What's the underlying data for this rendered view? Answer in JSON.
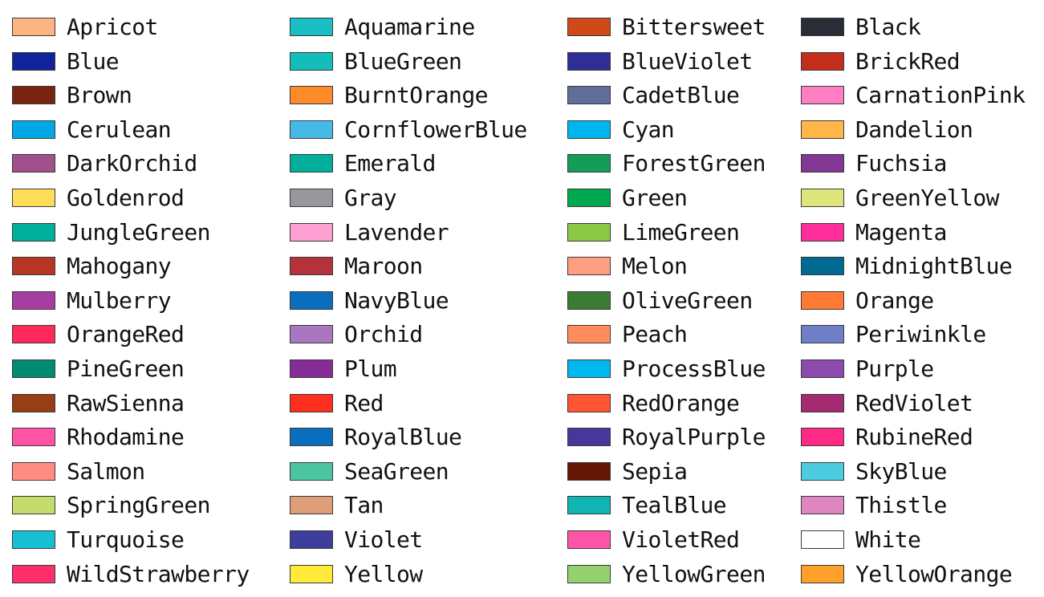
{
  "columns": [
    {
      "items": [
        {
          "name": "Apricot",
          "color": "#FBB482"
        },
        {
          "name": "Blue",
          "color": "#10239A"
        },
        {
          "name": "Brown",
          "color": "#792310"
        },
        {
          "name": "Cerulean",
          "color": "#00A9E6"
        },
        {
          "name": "DarkOrchid",
          "color": "#A2508C"
        },
        {
          "name": "Goldenrod",
          "color": "#FFDC5A"
        },
        {
          "name": "JungleGreen",
          "color": "#00B09C"
        },
        {
          "name": "Mahogany",
          "color": "#B73525"
        },
        {
          "name": "Mulberry",
          "color": "#A63EA0"
        },
        {
          "name": "OrangeRed",
          "color": "#FF2A5A"
        },
        {
          "name": "PineGreen",
          "color": "#008B72"
        },
        {
          "name": "RawSienna",
          "color": "#973E12"
        },
        {
          "name": "Rhodamine",
          "color": "#FF53A5"
        },
        {
          "name": "Salmon",
          "color": "#FF8C82"
        },
        {
          "name": "SpringGreen",
          "color": "#C4DC6A"
        },
        {
          "name": "Turquoise",
          "color": "#16C0D2"
        },
        {
          "name": "WildStrawberry",
          "color": "#FF2E6A"
        }
      ]
    },
    {
      "items": [
        {
          "name": "Aquamarine",
          "color": "#19BFC3"
        },
        {
          "name": "BlueGreen",
          "color": "#13BDBA"
        },
        {
          "name": "BurntOrange",
          "color": "#FF8A2A"
        },
        {
          "name": "CornflowerBlue",
          "color": "#46BAE6"
        },
        {
          "name": "Emerald",
          "color": "#00AE9B"
        },
        {
          "name": "Gray",
          "color": "#98989C"
        },
        {
          "name": "Lavender",
          "color": "#FFA0D2"
        },
        {
          "name": "Maroon",
          "color": "#B5323A"
        },
        {
          "name": "NavyBlue",
          "color": "#0A6EBE"
        },
        {
          "name": "Orchid",
          "color": "#A877BF"
        },
        {
          "name": "Plum",
          "color": "#852C96"
        },
        {
          "name": "Red",
          "color": "#FF2E1F"
        },
        {
          "name": "RoyalBlue",
          "color": "#0A6EBF"
        },
        {
          "name": "SeaGreen",
          "color": "#4AC59F"
        },
        {
          "name": "Tan",
          "color": "#DE9E7A"
        },
        {
          "name": "Violet",
          "color": "#3D3D9B"
        },
        {
          "name": "Yellow",
          "color": "#FFEA3A"
        }
      ]
    },
    {
      "items": [
        {
          "name": "Bittersweet",
          "color": "#CF4A18"
        },
        {
          "name": "BlueViolet",
          "color": "#2E2E96"
        },
        {
          "name": "CadetBlue",
          "color": "#606E9A"
        },
        {
          "name": "Cyan",
          "color": "#00B6EF"
        },
        {
          "name": "ForestGreen",
          "color": "#129E58"
        },
        {
          "name": "Green",
          "color": "#00A850"
        },
        {
          "name": "LimeGreen",
          "color": "#8BC846"
        },
        {
          "name": "Melon",
          "color": "#FF9E80"
        },
        {
          "name": "OliveGreen",
          "color": "#3C7B33"
        },
        {
          "name": "Peach",
          "color": "#FF8D5C"
        },
        {
          "name": "ProcessBlue",
          "color": "#00B8EF"
        },
        {
          "name": "RedOrange",
          "color": "#FF5533"
        },
        {
          "name": "RoyalPurple",
          "color": "#48369A"
        },
        {
          "name": "Sepia",
          "color": "#651503"
        },
        {
          "name": "TealBlue",
          "color": "#10B5B3"
        },
        {
          "name": "VioletRed",
          "color": "#FF55A8"
        },
        {
          "name": "YellowGreen",
          "color": "#93D16E"
        }
      ]
    },
    {
      "items": [
        {
          "name": "Black",
          "color": "#2A2D35"
        },
        {
          "name": "BrickRed",
          "color": "#C32D1C"
        },
        {
          "name": "CarnationPink",
          "color": "#FF7FC2"
        },
        {
          "name": "Dandelion",
          "color": "#FFB54A"
        },
        {
          "name": "Fuchsia",
          "color": "#833795"
        },
        {
          "name": "GreenYellow",
          "color": "#DDE57B"
        },
        {
          "name": "Magenta",
          "color": "#FF2E9C"
        },
        {
          "name": "MidnightBlue",
          "color": "#006A92"
        },
        {
          "name": "Orange",
          "color": "#FF7A35"
        },
        {
          "name": "Periwinkle",
          "color": "#6E7FC8"
        },
        {
          "name": "Purple",
          "color": "#8C4AAF"
        },
        {
          "name": "RedViolet",
          "color": "#A52B70"
        },
        {
          "name": "RubineRed",
          "color": "#FF2A86"
        },
        {
          "name": "SkyBlue",
          "color": "#4BCCE0"
        },
        {
          "name": "Thistle",
          "color": "#DD86C1"
        },
        {
          "name": "White",
          "color": "#FFFFFF"
        },
        {
          "name": "YellowOrange",
          "color": "#FFA02A"
        }
      ]
    }
  ]
}
